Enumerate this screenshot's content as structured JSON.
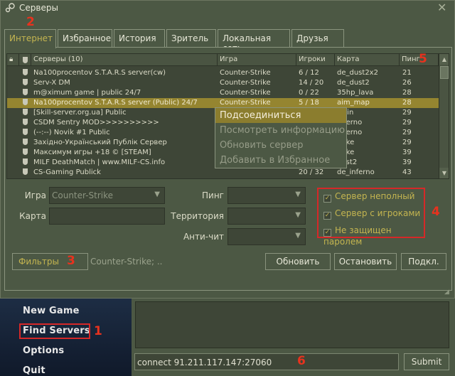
{
  "window": {
    "title": "Серверы"
  },
  "tabs": [
    "Интернет",
    "Избранное",
    "История",
    "Зритель",
    "Локальная сеть",
    "Друзья"
  ],
  "table": {
    "headers": {
      "servers": "Серверы (10)",
      "game": "Игра",
      "players": "Игроки",
      "map": "Карта",
      "ping": "Пинг"
    },
    "rows": [
      {
        "name": "Na100procentov S.T.A.R.S server(cw)",
        "game": "Counter-Strike",
        "players": "6 / 12",
        "map": "de_dust2x2",
        "ping": "21"
      },
      {
        "name": "Serv-X DM",
        "game": "Counter-Strike",
        "players": "14 / 20",
        "map": "de_dust2",
        "ping": "26"
      },
      {
        "name": "m@ximum game | public 24/7",
        "game": "Counter-Strike",
        "players": "0 / 22",
        "map": "35hp_lava",
        "ping": "28"
      },
      {
        "name": "Na100procentov S.T.A.R.S server (Public) 24/7",
        "game": "Counter-Strike",
        "players": "5 / 18",
        "map": "aim_map",
        "ping": "28"
      },
      {
        "name": "[Skill-server.org.ua] Public",
        "game": "",
        "players": "",
        "map": "train",
        "ping": "29"
      },
      {
        "name": "CSDM Sentry MOD>>>>>>>>>>",
        "game": "",
        "players": "",
        "map": "inferno",
        "ping": "29"
      },
      {
        "name": "(--:--) Novik #1 Public",
        "game": "",
        "players": "",
        "map": "inferno",
        "ping": "29"
      },
      {
        "name": "Західно-Український Публік Сервер",
        "game": "",
        "players": "",
        "map": "nuke",
        "ping": "29"
      },
      {
        "name": "Максимум игры +18 © [STEAM]",
        "game": "",
        "players": "",
        "map": "nuke",
        "ping": "39"
      },
      {
        "name": "MILF DeathMatch | www.MILF-CS.info",
        "game": "",
        "players": "",
        "map": "dust2",
        "ping": "39"
      },
      {
        "name": "CS-Gaming Publick",
        "game": "",
        "players": "20 / 32",
        "map": "de_inferno",
        "ping": "43"
      }
    ]
  },
  "context_menu": [
    "Подсоединиться",
    "Посмотреть информацию",
    "Обновить сервер",
    "Добавить в Избранное"
  ],
  "filters": {
    "game_label": "Игра",
    "game_value": "Counter-Strike",
    "map_label": "Карта",
    "ping_label": "Пинг",
    "territory_label": "Территория",
    "anticheat_label": "Анти-чит",
    "checks": [
      "Сервер неполный",
      "Сервер с игроками",
      "Не защищен паролем"
    ],
    "filter_button": "Фильтры",
    "filter_summary": "Counter-Strike; ..",
    "refresh": "Обновить",
    "stop": "Остановить",
    "connect": "Подкл."
  },
  "annotations": [
    "1",
    "2",
    "3",
    "4",
    "5",
    "6"
  ],
  "menu": [
    "New Game",
    "Find Servers",
    "Options",
    "Quit"
  ],
  "console": {
    "input": "connect 91.211.117.147:27060",
    "submit": "Submit"
  },
  "colors": {
    "panel": "#4c5844",
    "accent": "#c4b550",
    "selection": "#958530",
    "annotation": "#e8321e"
  }
}
